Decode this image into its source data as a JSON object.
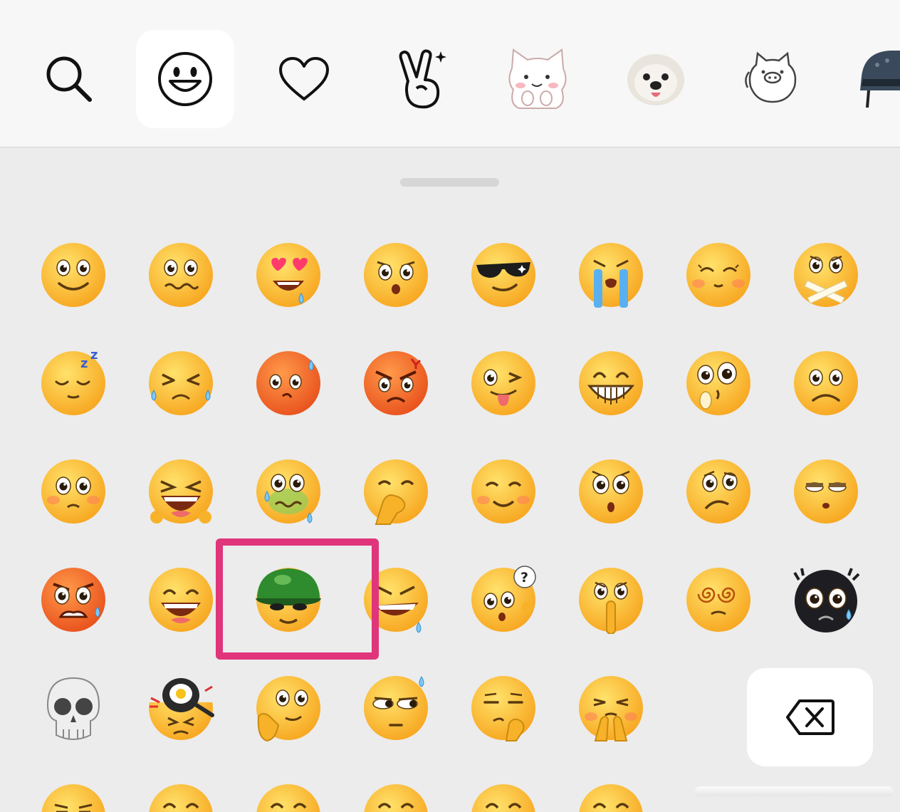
{
  "tabs": [
    {
      "name": "search",
      "icon": "search-icon"
    },
    {
      "name": "emoji",
      "icon": "smiley-icon",
      "selected": true
    },
    {
      "name": "favorites",
      "icon": "heart-icon"
    },
    {
      "name": "gestures",
      "icon": "victory-hand-icon"
    },
    {
      "name": "sticker-cat",
      "icon": "cat-sticker-icon"
    },
    {
      "name": "sticker-dog",
      "icon": "dog-sticker-icon"
    },
    {
      "name": "sticker-pig",
      "icon": "pig-sticker-icon"
    },
    {
      "name": "sticker-helmet",
      "icon": "helmet-sticker-icon"
    }
  ],
  "emoji_rows": [
    [
      "smile",
      "nervous-smile",
      "heart-eyes",
      "glare",
      "sunglasses",
      "crying-tears",
      "blushing-closed-eyes",
      "mouth-taped"
    ],
    [
      "sleepy-zzz",
      "laugh-tears",
      "hot-sweat",
      "angry-red",
      "wink-tongue",
      "big-grin",
      "shocked-hand",
      "sad"
    ],
    [
      "embarrassed",
      "roaring-laugh",
      "sick-teary",
      "hmm-covering-mouth",
      "content-smile",
      "surprised-o",
      "confused",
      "unimpressed"
    ],
    [
      "angry-sweat",
      "happy-grin",
      "green-hat",
      "evil-laugh",
      "question-mark",
      "shush",
      "dizzy",
      "black-scared"
    ],
    [
      "skull",
      "frying-pan",
      "face-palm-thinking",
      "side-eye-sweat",
      "smirk-thinking",
      "praying-blush"
    ],
    [
      "squint-laugh",
      "hidden",
      "hidden",
      "hidden",
      "hidden",
      "hidden"
    ]
  ],
  "highlighted_emoji": "green-hat",
  "colors": {
    "face_yellow": "#fdc43a",
    "face_orange": "#f3722c",
    "highlight": "#e0357a",
    "helmet_green": "#2e8b2e"
  },
  "delete_key_icon": "backspace-icon"
}
